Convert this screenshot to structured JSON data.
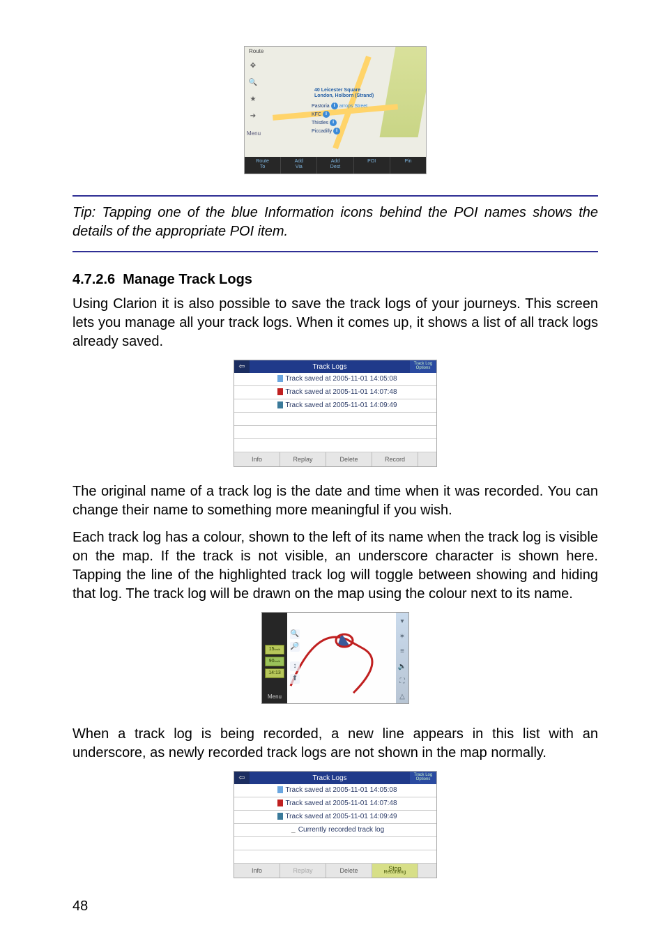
{
  "page_number": "48",
  "map_screenshot": {
    "topbar": "Route",
    "center_label1": "40 Leicester Square",
    "center_label2": "London, Holborn (Strand)",
    "pois": [
      {
        "name": "Pastoria"
      },
      {
        "name": "KFC"
      },
      {
        "name": "Thistles"
      },
      {
        "name": "Piccadilly"
      }
    ],
    "street_hint": "arrops Street",
    "bottom_buttons": [
      {
        "line1": "Route",
        "line2": "To"
      },
      {
        "line1": "Add",
        "line2": "Via"
      },
      {
        "line1": "Add",
        "line2": "Dest"
      },
      {
        "line1": "POI",
        "line2": ""
      },
      {
        "line1": "Pin",
        "line2": ""
      }
    ],
    "menu_label": "Menu"
  },
  "tip": "Tip: Tapping one of the blue Information icons behind the POI names shows the details of the appropriate POI item.",
  "section": {
    "number": "4.7.2.6",
    "title": "Manage Track Logs"
  },
  "paragraphs": {
    "p1": "Using Clarion it is also possible to save the track logs of your journeys. This screen lets you manage all your track logs. When it comes up, it shows a list of all track logs already saved.",
    "p2": "The original name of a track log is the date and time when it was recorded. You can change their name to something more meaningful if you wish.",
    "p3": "Each track log has a colour, shown to the left of its name when the track log is visible on the map. If the track is not visible, an underscore character is shown here. Tapping the line of the highlighted track log will toggle between showing and hiding that log. The track log will be drawn on the map using the colour next to its name.",
    "p4": "When a track log is being recorded, a new line appears in this list with an underscore, as newly recorded track logs are not shown in the map normally."
  },
  "tracklogs_header": {
    "title": "Track Logs",
    "options": "Track Log Options"
  },
  "tracklogs_list1": {
    "rows": [
      {
        "color": "#6aa6e0",
        "label": "Track saved at 2005-11-01 14:05:08"
      },
      {
        "color": "#c02020",
        "label": "Track saved at 2005-11-01 14:07:48"
      },
      {
        "color": "#3a7a9a",
        "label": "Track saved at 2005-11-01 14:09:49"
      }
    ],
    "footer": [
      "Info",
      "Replay",
      "Delete",
      "Record"
    ]
  },
  "tracklogs_list2": {
    "rows": [
      {
        "color": "#6aa6e0",
        "label": "Track saved at 2005-11-01 14:05:08"
      },
      {
        "color": "#c02020",
        "label": "Track saved at 2005-11-01 14:07:48"
      },
      {
        "color": "#3a7a9a",
        "label": "Track saved at 2005-11-01 14:09:49"
      },
      {
        "underscore": true,
        "label": "Currently recorded track log"
      }
    ],
    "footer_left": [
      "Info",
      "Replay",
      "Delete"
    ],
    "footer_right": {
      "line1": "Stop",
      "line2": "Recording"
    }
  },
  "map_tracklog_view": {
    "stats": [
      "15",
      "90",
      "14:13"
    ],
    "unit": "km/h",
    "menu": "Menu"
  }
}
